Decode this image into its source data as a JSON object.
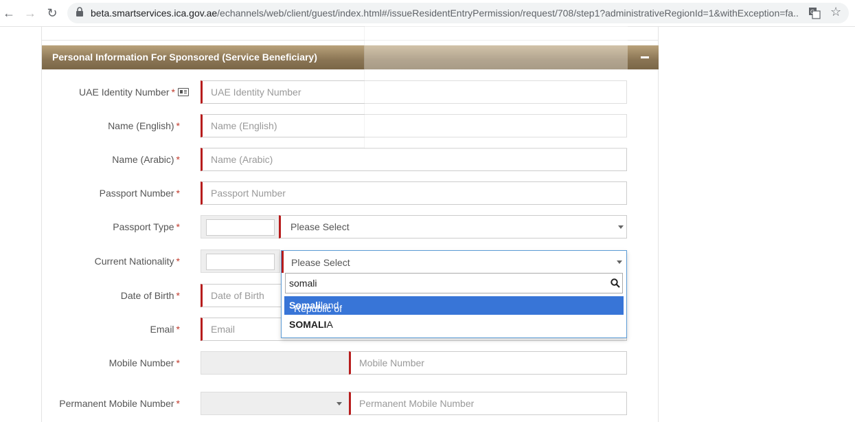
{
  "browser": {
    "url_host": "beta.smartservices.ica.gov.ae",
    "url_path": "/echannels/web/client/guest/index.html#/issueResidentEntryPermission/request/708/step1?administrativeRegionId=1&withException=fa..."
  },
  "panel": {
    "title": "Personal Information For Sponsored (Service Beneficiary)"
  },
  "fields": {
    "uae_id": {
      "label": "UAE Identity Number",
      "placeholder": "UAE Identity Number"
    },
    "name_en": {
      "label": "Name (English)",
      "placeholder": "Name (English)"
    },
    "name_ar": {
      "label": "Name (Arabic)",
      "placeholder": "Name (Arabic)"
    },
    "passport_no": {
      "label": "Passport Number",
      "placeholder": "Passport Number"
    },
    "passport_type": {
      "label": "Passport Type",
      "value": "Please Select"
    },
    "nationality": {
      "label": "Current Nationality",
      "value": "Please Select"
    },
    "dob": {
      "label": "Date of Birth",
      "placeholder": "Date of Birth"
    },
    "email": {
      "label": "Email",
      "placeholder": "Email"
    },
    "mobile": {
      "label": "Mobile Number",
      "placeholder": "Mobile Number"
    },
    "perm_mobile": {
      "label": "Permanent Mobile Number",
      "placeholder": "Permanent Mobile Number"
    }
  },
  "required_mark": "*",
  "dropdown": {
    "search_text": "somali",
    "options": [
      {
        "prefix": "Republic of ",
        "match": "Somali",
        "suffix": "land"
      },
      {
        "prefix": "",
        "match": "SOMALI",
        "suffix": "A"
      }
    ]
  },
  "icons": {
    "back": "back-arrow-icon",
    "forward": "forward-arrow-icon",
    "reload": "reload-icon",
    "lock": "lock-icon",
    "translate": "translate-icon",
    "bookmark": "star-icon",
    "collapse": "minus-icon",
    "id_card": "id-card-icon",
    "search": "search-icon"
  },
  "colors": {
    "header_gradient_top": "#b9a27b",
    "header_gradient_bottom": "#7a6647",
    "required_border": "#b71c1c",
    "highlight": "#3875d7"
  }
}
